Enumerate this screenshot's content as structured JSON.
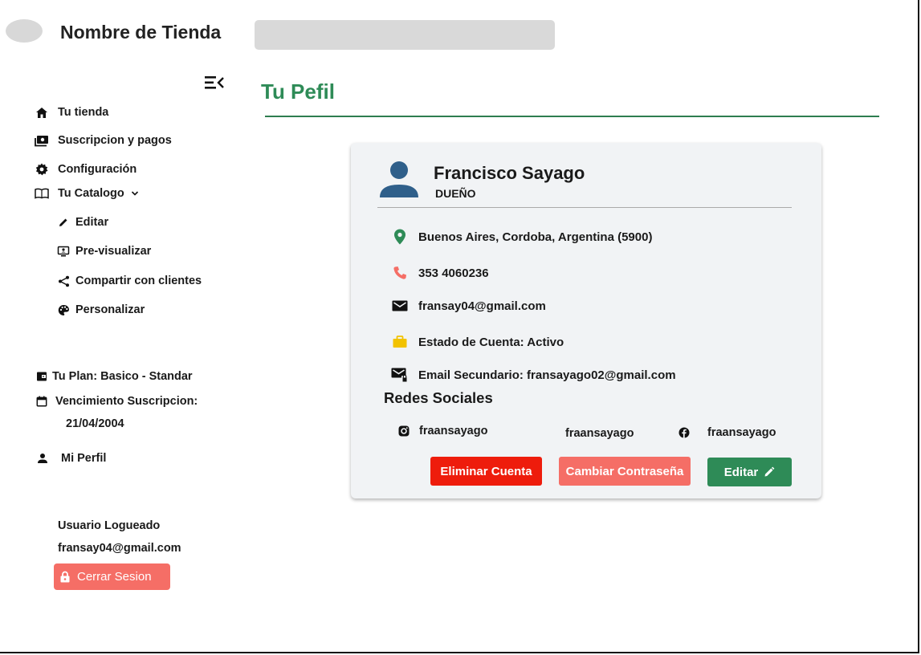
{
  "header": {
    "store_name": "Nombre de Tienda",
    "search_placeholder": ""
  },
  "sidebar": {
    "items": [
      {
        "label": "Tu tienda",
        "icon": "home-icon"
      },
      {
        "label": "Suscripcion y pagos",
        "icon": "payments-icon"
      },
      {
        "label": "Configuración",
        "icon": "gear-icon"
      },
      {
        "label": "Tu Catalogo",
        "icon": "book-icon"
      }
    ],
    "catalog_subitems": [
      {
        "label": "Editar",
        "icon": "pencil-icon"
      },
      {
        "label": "Pre-visualizar",
        "icon": "preview-icon"
      },
      {
        "label": "Compartir con clientes",
        "icon": "share-icon"
      },
      {
        "label": "Personalizar",
        "icon": "palette-icon"
      }
    ],
    "plan_label": "Tu Plan: Basico - Standar",
    "expiry_label": "Vencimiento Suscripcion:",
    "expiry_date": "21/04/2004",
    "profile_label": "Mi Perfil",
    "logged_user_label": "Usuario Logueado",
    "logged_user_email": "fransay04@gmail.com",
    "logout_label": "Cerrar Sesion"
  },
  "main": {
    "title": "Tu Pefil",
    "profile": {
      "name": "Francisco Sayago",
      "role": "DUEÑO",
      "location": "Buenos Aires, Cordoba, Argentina (5900)",
      "phone": "353 4060236",
      "email": "fransay04@gmail.com",
      "account_status": "Estado de Cuenta: Activo",
      "secondary_email": "Email Secundario: fransayago02@gmail.com"
    },
    "social": {
      "title": "Redes Sociales",
      "instagram": "fraansayago",
      "middle": "fraansayago",
      "facebook": "fraansayago"
    },
    "buttons": {
      "delete": "Eliminar Cuenta",
      "change_password": "Cambiar Contraseña",
      "edit": "Editar"
    }
  },
  "colors": {
    "accent_green": "#2e8b57",
    "danger_red": "#ee1c0c",
    "salmon": "#f56e66",
    "avatar_blue": "#2f5f8a",
    "status_yellow": "#f2c200"
  }
}
